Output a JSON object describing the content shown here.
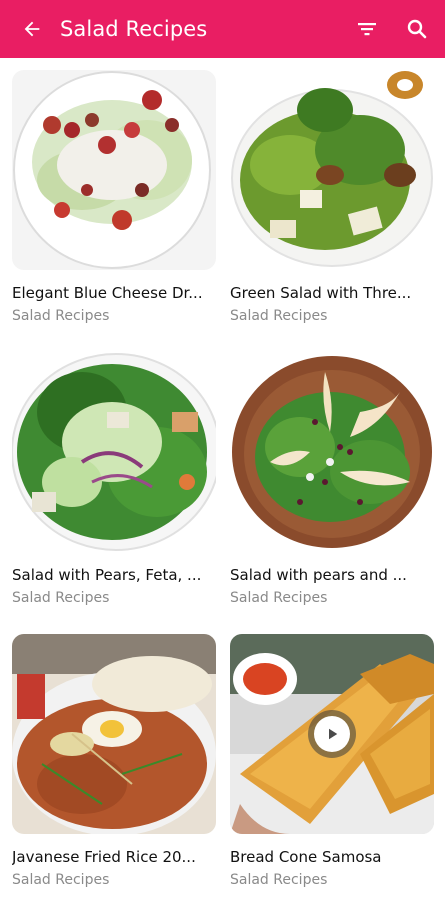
{
  "app_bar": {
    "title": "Salad Recipes",
    "background": "#e91e63",
    "back_icon": "arrow-left-icon",
    "filter_icon": "filter-icon",
    "search_icon": "search-icon"
  },
  "recipes": [
    {
      "name": "Elegant Blue Cheese Dr...",
      "category": "Salad Recipes"
    },
    {
      "name": "Green Salad with Thre...",
      "category": "Salad Recipes"
    },
    {
      "name": "Salad with Pears, Feta, ...",
      "category": "Salad Recipes"
    },
    {
      "name": "Salad with pears and ...",
      "category": "Salad Recipes"
    },
    {
      "name": "Javanese Fried Rice 20...",
      "category": "Salad Recipes"
    },
    {
      "name": "Bread Cone Samosa",
      "category": "Salad Recipes",
      "has_video": true,
      "video_icon": "play-icon"
    }
  ]
}
